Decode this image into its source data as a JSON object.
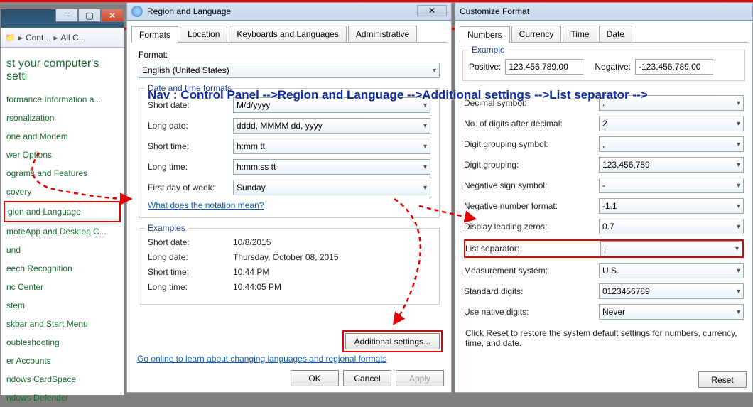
{
  "annotation": "Nav : Control Panel -->Region and Language -->Additional settings -->List separator -->",
  "cp": {
    "bc_item1": "Cont...",
    "bc_item2": "All C...",
    "heading": "st your computer's setti",
    "items": [
      "formance Information a...",
      "rsonalization",
      "one and Modem",
      "wer Options",
      "ograms and Features",
      "covery",
      "gion and Language",
      "moteApp and Desktop C...",
      "und",
      "eech Recognition",
      "nc Center",
      "stem",
      "skbar and Start Menu",
      "oubleshooting",
      "er Accounts",
      "ndows CardSpace",
      "ndows Defender"
    ],
    "hl_index": 6
  },
  "region": {
    "title": "Region and Language",
    "tabs": [
      "Formats",
      "Location",
      "Keyboards and Languages",
      "Administrative"
    ],
    "format_label": "Format:",
    "format_value": "English (United States)",
    "dtgroup": "Date and time formats",
    "shortdate_l": "Short date:",
    "shortdate_v": "M/d/yyyy",
    "longdate_l": "Long date:",
    "longdate_v": "dddd, MMMM dd, yyyy",
    "shorttime_l": "Short time:",
    "shorttime_v": "h:mm tt",
    "longtime_l": "Long time:",
    "longtime_v": "h:mm:ss tt",
    "firstday_l": "First day of week:",
    "firstday_v": "Sunday",
    "notation_link": "What does the notation mean?",
    "ex_group": "Examples",
    "ex_sd_l": "Short date:",
    "ex_sd_v": "10/8/2015",
    "ex_ld_l": "Long date:",
    "ex_ld_v": "Thursday, October 08, 2015",
    "ex_st_l": "Short time:",
    "ex_st_v": "10:44 PM",
    "ex_lt_l": "Long time:",
    "ex_lt_v": "10:44:05 PM",
    "addset": "Additional settings...",
    "online_link": "Go online to learn about changing languages and regional formats",
    "ok": "OK",
    "cancel": "Cancel",
    "apply": "Apply"
  },
  "custom": {
    "title": "Customize Format",
    "tabs": [
      "Numbers",
      "Currency",
      "Time",
      "Date"
    ],
    "example_group": "Example",
    "pos_l": "Positive:",
    "pos_v": "123,456,789.00",
    "neg_l": "Negative:",
    "neg_v": "-123,456,789.00",
    "rows": [
      {
        "l": "Decimal symbol:",
        "v": "."
      },
      {
        "l": "No. of digits after decimal:",
        "v": "2"
      },
      {
        "l": "Digit grouping symbol:",
        "v": ","
      },
      {
        "l": "Digit grouping:",
        "v": "123,456,789"
      },
      {
        "l": "Negative sign symbol:",
        "v": "-"
      },
      {
        "l": "Negative number format:",
        "v": "-1.1"
      },
      {
        "l": "Display leading zeros:",
        "v": "0.7"
      },
      {
        "l": "List separator:",
        "v": "|"
      },
      {
        "l": "Measurement system:",
        "v": "U.S."
      },
      {
        "l": "Standard digits:",
        "v": "0123456789"
      },
      {
        "l": "Use native digits:",
        "v": "Never"
      }
    ],
    "hl_index": 7,
    "reset_text": "Click Reset to restore the system default settings for numbers, currency, time, and date.",
    "reset": "Reset"
  }
}
